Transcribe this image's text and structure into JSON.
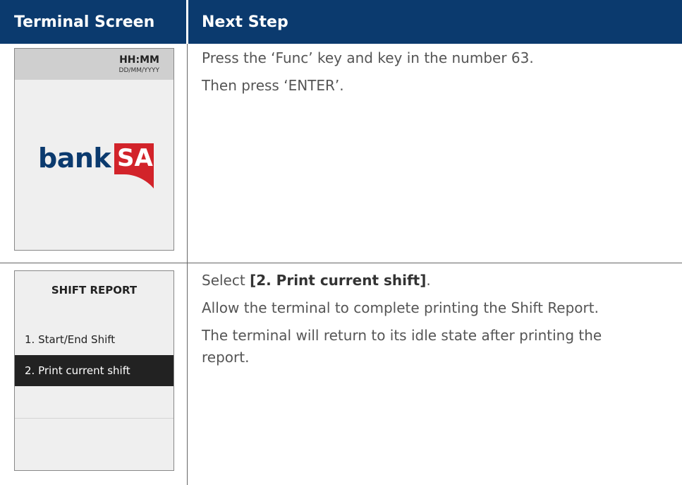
{
  "header": {
    "col1": "Terminal Screen",
    "col2": "Next Step"
  },
  "rows": [
    {
      "terminal": {
        "time": "HH:MM",
        "date": "DD/MM/YYYY",
        "logo_text_bank": "bank",
        "logo_text_sa": "SA"
      },
      "steps": [
        "Press the ‘Func’ key and key in the number 63.",
        "Then press ‘ENTER’."
      ]
    },
    {
      "terminal": {
        "title": "SHIFT REPORT",
        "menu": [
          "1. Start/End Shift",
          "2. Print current shift"
        ]
      },
      "steps": [
        {
          "prefix": "Select ",
          "bold": "[2. Print current shift]",
          "suffix": "."
        },
        "Allow the terminal to complete printing the Shift Report.",
        "The terminal will return to its idle state after printing the",
        "report."
      ]
    }
  ],
  "colors": {
    "header_bg": "#0b3a6e",
    "brand_red": "#d2232a",
    "brand_navy": "#0b3a6e",
    "terminal_bg": "#efefef",
    "highlight_bg": "#222222"
  }
}
